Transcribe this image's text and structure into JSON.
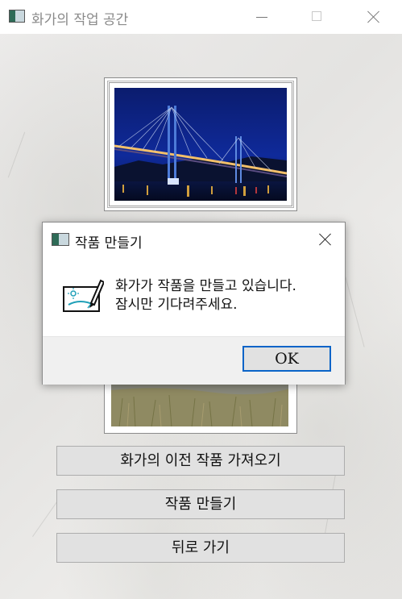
{
  "window": {
    "title": "화가의 작업 공간",
    "icon": "app-window-icon",
    "controls": [
      "minimize",
      "maximize",
      "close"
    ]
  },
  "gallery": {
    "painting_top": "bridge-night-painting",
    "painting_bottom": "field-landscape-painting"
  },
  "buttons": {
    "load_previous": "화가의 이전 작품 가져오기",
    "create_artwork": "작품 만들기",
    "go_back": "뒤로 가기"
  },
  "dialog": {
    "title": "작품 만들기",
    "message_line1": "화가가 작품을 만들고 있습니다.",
    "message_line2": "잠시만 기다려주세요.",
    "ok_label": "OK",
    "icon": "drawing-tablet-icon"
  },
  "colors": {
    "accent_focus": "#0a64c8",
    "button_bg": "#e1e1e1",
    "title_text": "#8a8a8a"
  }
}
